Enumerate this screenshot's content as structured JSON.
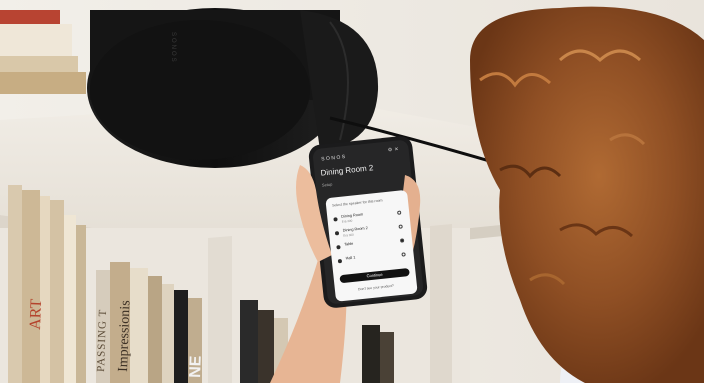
{
  "photo": {
    "speaker_brand": "SONOS",
    "spines": {
      "art": "ART",
      "impressionists": "Impressionis",
      "passing": "PASSING T",
      "ne": "NE"
    }
  },
  "phone": {
    "app_brand": "SONOS",
    "room_title": "Dining Room 2",
    "sub_label": "Setup",
    "prompt": "Select the speaker for this room",
    "speakers": [
      {
        "name": "Dining Room",
        "meta": "Era 300",
        "selected": false
      },
      {
        "name": "Dining Room 2",
        "meta": "Era 300",
        "selected": false
      },
      {
        "name": "Table",
        "meta": "",
        "selected": true
      },
      {
        "name": "Hall 1",
        "meta": "",
        "selected": false
      }
    ],
    "continue_label": "Continue",
    "help_text": "Don't see your product?"
  },
  "colors": {
    "speaker": "#141414",
    "shelf": "#ece7df",
    "phone_body": "#1b1b1c",
    "hair": "#9a5a2c"
  }
}
